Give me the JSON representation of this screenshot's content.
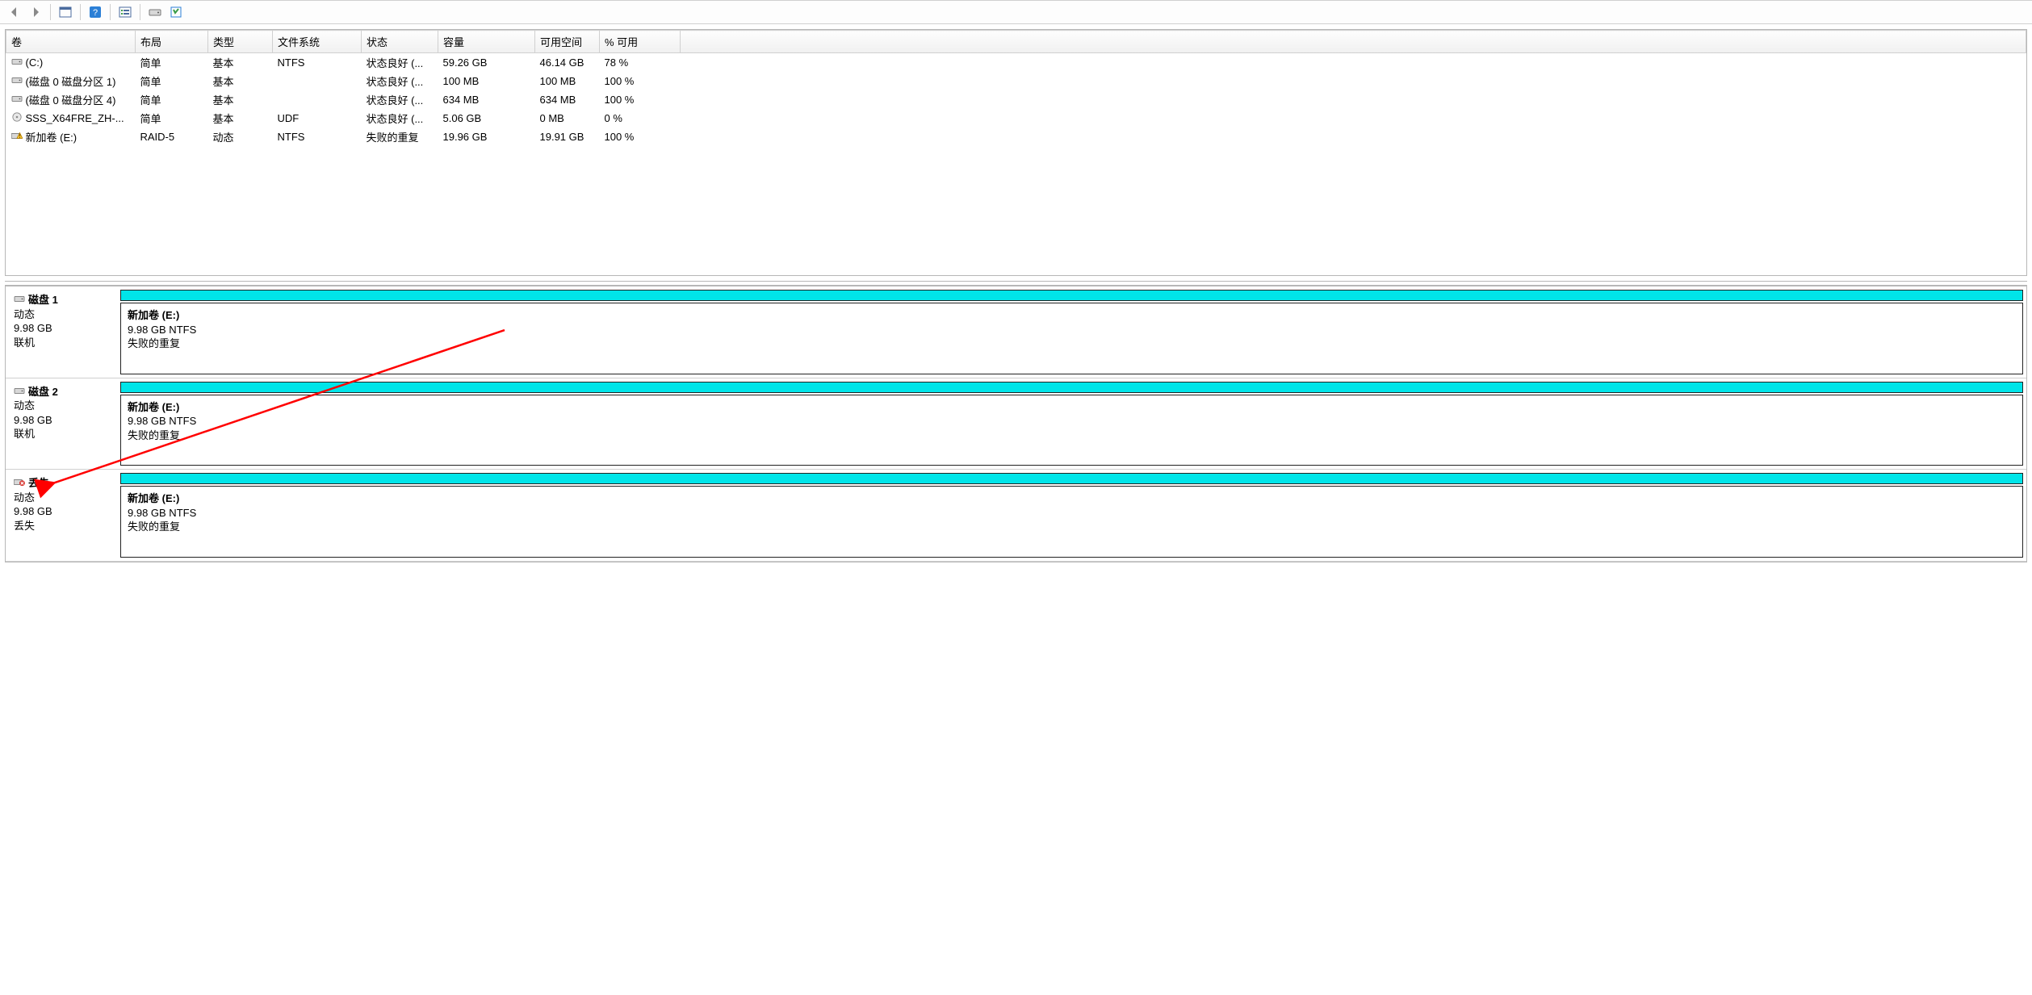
{
  "toolbar": {
    "back": "后退",
    "forward": "前进",
    "showhide": "显示/隐藏",
    "help": "帮助",
    "action": "操作",
    "disk": "磁盘",
    "props": "属性"
  },
  "columns": {
    "volume": "卷",
    "layout": "布局",
    "type": "类型",
    "filesystem": "文件系统",
    "status": "状态",
    "capacity": "容量",
    "free": "可用空间",
    "pctfree": "% 可用"
  },
  "volumes": [
    {
      "icon": "drive",
      "name": "(C:)",
      "layout": "简单",
      "type": "基本",
      "fs": "NTFS",
      "status": "状态良好 (...",
      "cap": "59.26 GB",
      "free": "46.14 GB",
      "pct": "78 %"
    },
    {
      "icon": "drive",
      "name": "(磁盘 0 磁盘分区 1)",
      "layout": "简单",
      "type": "基本",
      "fs": "",
      "status": "状态良好 (...",
      "cap": "100 MB",
      "free": "100 MB",
      "pct": "100 %"
    },
    {
      "icon": "drive",
      "name": "(磁盘 0 磁盘分区 4)",
      "layout": "简单",
      "type": "基本",
      "fs": "",
      "status": "状态良好 (...",
      "cap": "634 MB",
      "free": "634 MB",
      "pct": "100 %"
    },
    {
      "icon": "cd",
      "name": "SSS_X64FRE_ZH-...",
      "layout": "简单",
      "type": "基本",
      "fs": "UDF",
      "status": "状态良好 (...",
      "cap": "5.06 GB",
      "free": "0 MB",
      "pct": "0 %"
    },
    {
      "icon": "warn",
      "name": "新加卷 (E:)",
      "layout": "RAID-5",
      "type": "动态",
      "fs": "NTFS",
      "status": "失败的重复",
      "cap": "19.96 GB",
      "free": "19.91 GB",
      "pct": "100 %"
    }
  ],
  "disks": [
    {
      "icon": "drive",
      "title": "磁盘 1",
      "type": "动态",
      "size": "9.98 GB",
      "state": "联机",
      "vol_name": "新加卷  (E:)",
      "vol_desc": "9.98 GB NTFS",
      "vol_status": "失败的重复"
    },
    {
      "icon": "drive",
      "title": "磁盘 2",
      "type": "动态",
      "size": "9.98 GB",
      "state": "联机",
      "vol_name": "新加卷  (E:)",
      "vol_desc": "9.98 GB NTFS",
      "vol_status": "失败的重复"
    },
    {
      "icon": "error",
      "title": "丢失",
      "type": "动态",
      "size": "9.98 GB",
      "state": "丢失",
      "vol_name": "新加卷  (E:)",
      "vol_desc": "9.98 GB NTFS",
      "vol_status": "失败的重复"
    }
  ]
}
